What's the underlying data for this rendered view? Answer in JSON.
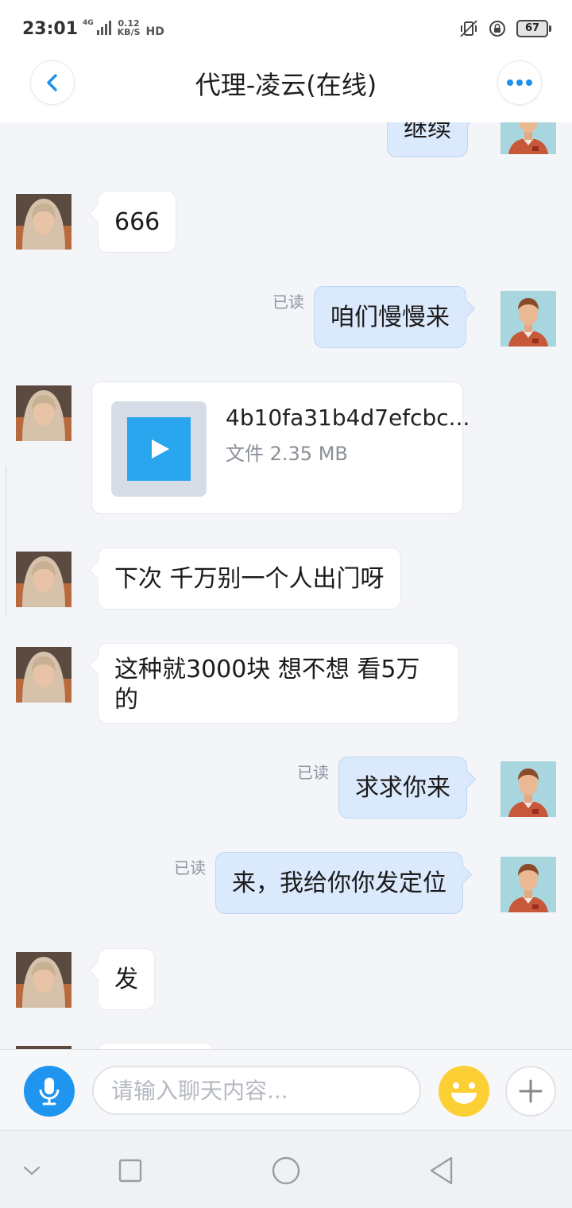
{
  "status_bar": {
    "time": "23:01",
    "network": "4G",
    "speed_value": "0.12",
    "speed_unit": "KB/S",
    "hd": "HD",
    "battery": "67",
    "icons": [
      "vibrate-icon",
      "rotation-lock-icon",
      "battery-icon"
    ]
  },
  "header": {
    "title": "代理-凌云(在线)",
    "back_icon": "chevron-left-icon",
    "more_icon": "more-dots-icon"
  },
  "messages": [
    {
      "side": "out",
      "text": "继续",
      "partial": true
    },
    {
      "side": "in",
      "text": "666"
    },
    {
      "side": "out",
      "text": "咱们慢慢来",
      "read_label": "已读"
    },
    {
      "side": "in",
      "type": "file",
      "file_name": "4b10fa31b4d7efcbc...",
      "file_meta": "文件 2.35 MB",
      "icon": "play-icon"
    },
    {
      "side": "in",
      "text": "下次 千万别一个人出门呀"
    },
    {
      "side": "in",
      "text": "这种就3000块 想不想 看5万的"
    },
    {
      "side": "out",
      "text": "求求你来",
      "read_label": "已读"
    },
    {
      "side": "out",
      "text": "来，我给你你发定位",
      "read_label": "已读"
    },
    {
      "side": "in",
      "text": "发"
    }
  ],
  "input_bar": {
    "placeholder": "请输入聊天内容...",
    "voice_icon": "microphone-icon",
    "emoji_icon": "emoji-icon",
    "plus_icon": "plus-icon"
  },
  "nav_bar": {
    "icons": [
      "chevron-down-icon",
      "recents-square-icon",
      "home-circle-icon",
      "back-triangle-icon"
    ]
  },
  "colors": {
    "accent": "#1f95ef",
    "outgoing_bubble": "#dbe9fc",
    "background": "#f3f5f8",
    "emoji": "#fcd034"
  }
}
